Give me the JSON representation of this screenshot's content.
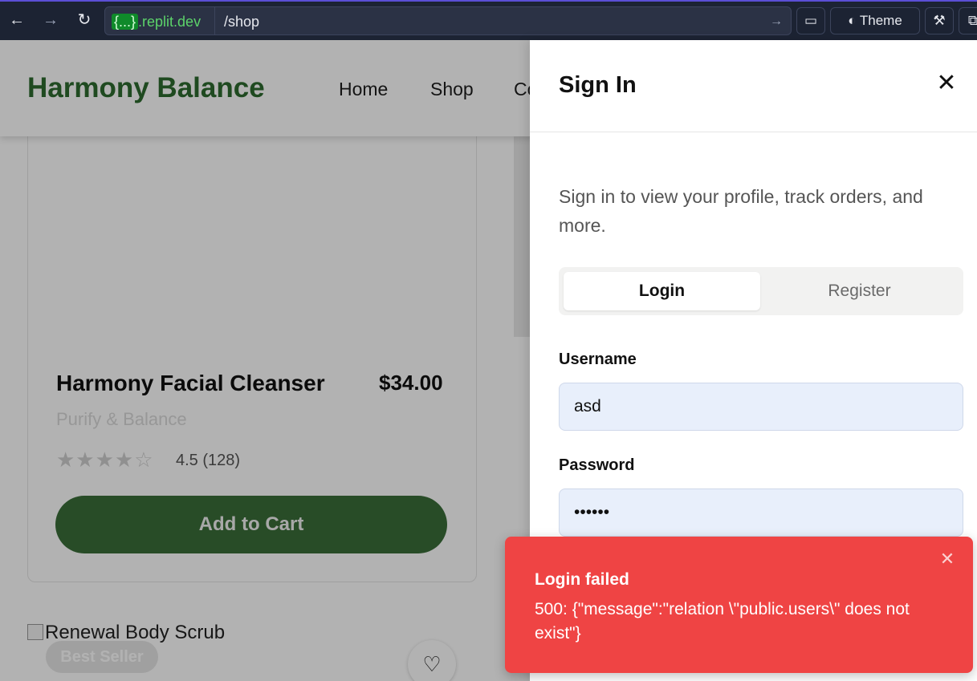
{
  "browser": {
    "url_host_brace": "{...}",
    "url_host_rest": ".replit.dev",
    "url_path": "/shop",
    "theme_label": "Theme"
  },
  "site": {
    "brand": "Harmony Balance",
    "nav": [
      "Home",
      "Shop",
      "Co"
    ]
  },
  "product": {
    "name": "Harmony Facial Cleanser",
    "price": "$34.00",
    "subtitle": "Purify & Balance",
    "stars": "★★★★☆",
    "rating_text": "4.5 (128)",
    "add_to_cart": "Add to Cart",
    "next_image_alt": "Renewal Body Scrub",
    "badge": "Best Seller"
  },
  "drawer": {
    "title": "Sign In",
    "intro": "Sign in to view your profile, track orders, and more.",
    "tabs": [
      "Login",
      "Register"
    ],
    "username_label": "Username",
    "username_value": "asd",
    "password_label": "Password",
    "password_value": "••••••"
  },
  "toast": {
    "title": "Login failed",
    "message": "500: {\"message\":\"relation \\\"public.users\\\" does not exist\"}"
  }
}
